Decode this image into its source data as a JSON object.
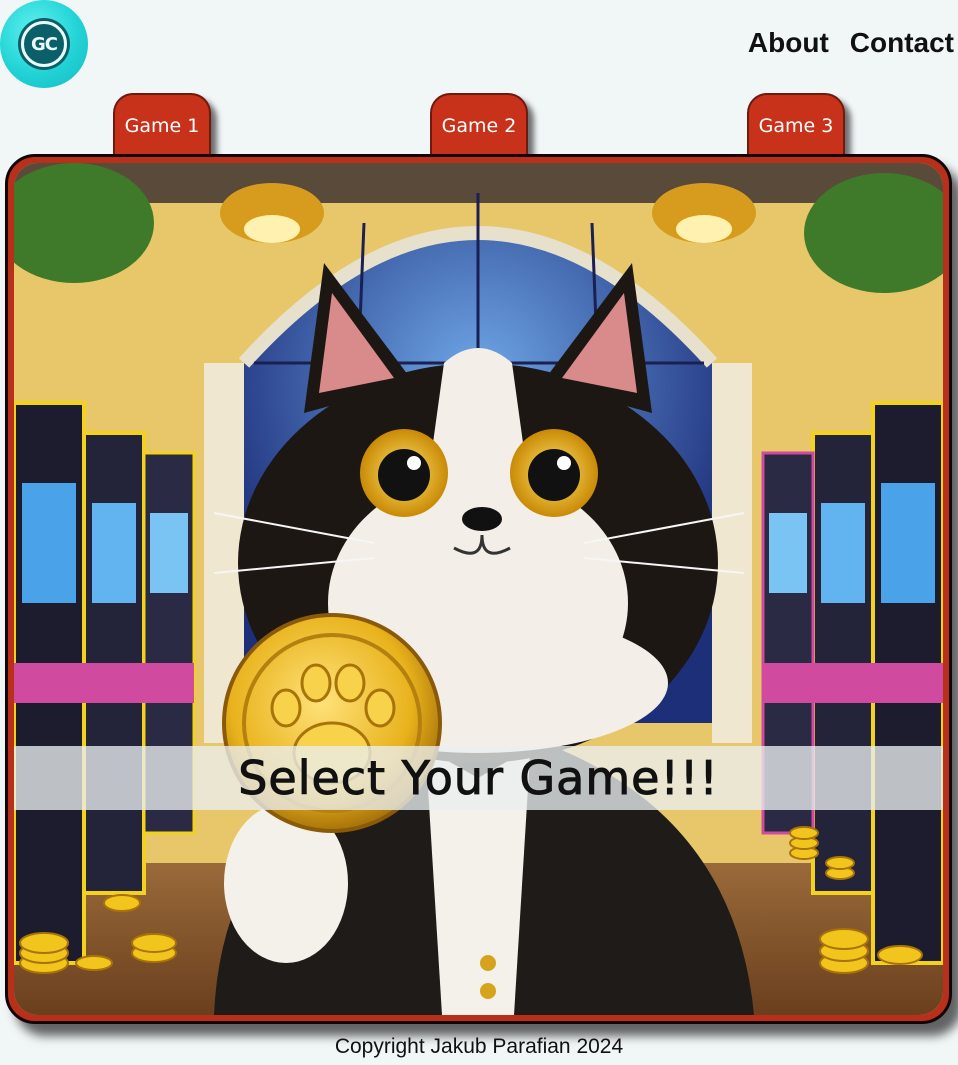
{
  "header": {
    "logo_text": "GC",
    "nav": [
      {
        "label": "About"
      },
      {
        "label": "Contact"
      }
    ]
  },
  "tabs": [
    {
      "label": "Game 1"
    },
    {
      "label": "Game 2"
    },
    {
      "label": "Game 3"
    }
  ],
  "hero": {
    "banner_text": "Select Your Game!!!"
  },
  "footer": {
    "copyright": "Copyright Jakub Parafian 2024"
  },
  "colors": {
    "accent": "#c8311a",
    "logo": "#22d3d6",
    "background": "#f1f6f7"
  }
}
